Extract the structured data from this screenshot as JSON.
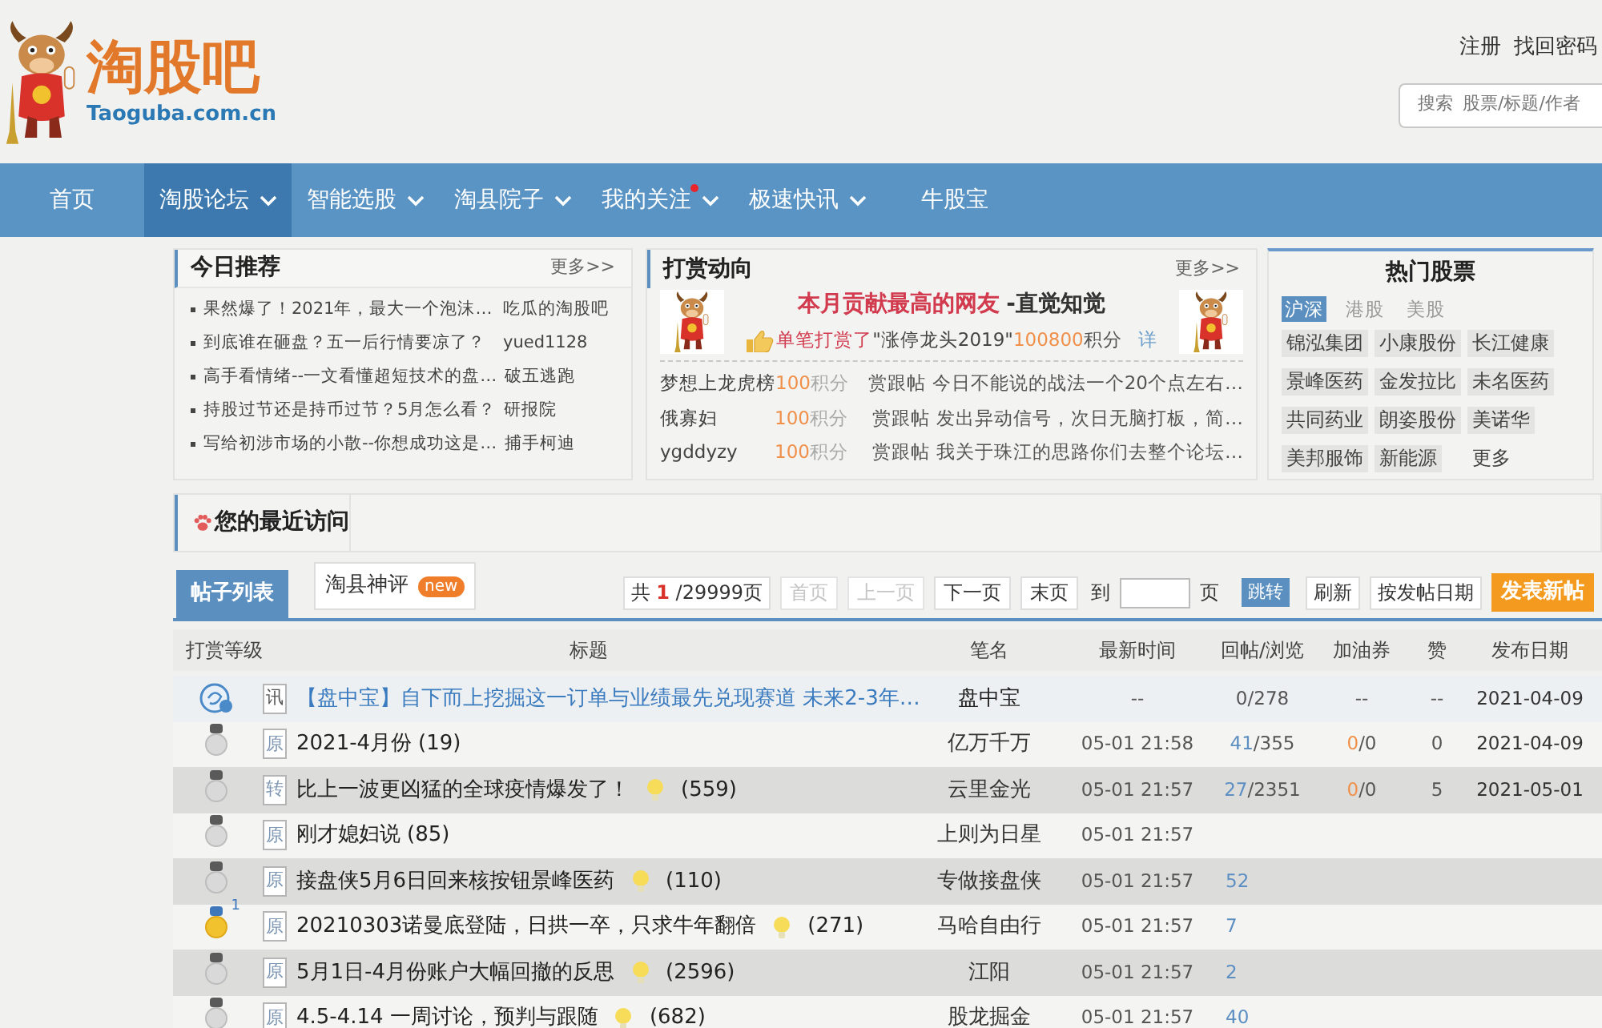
{
  "header": {
    "logo": {
      "name": "淘股吧",
      "domain": "Taoguba.com.cn"
    },
    "links": [
      "注册",
      "找回密码"
    ],
    "search": {
      "label": "搜索",
      "placeholder": "股票/标题/作者"
    }
  },
  "nav": [
    {
      "label": "首页",
      "selected": false,
      "dropdown": false,
      "dot": false
    },
    {
      "label": "淘股论坛",
      "selected": true,
      "dropdown": true,
      "dot": false
    },
    {
      "label": "智能选股",
      "selected": false,
      "dropdown": true,
      "dot": false
    },
    {
      "label": "淘县院子",
      "selected": false,
      "dropdown": true,
      "dot": false
    },
    {
      "label": "我的关注",
      "selected": false,
      "dropdown": true,
      "dot": true
    },
    {
      "label": "极速快讯",
      "selected": false,
      "dropdown": true,
      "dot": false
    },
    {
      "label": "牛股宝",
      "selected": false,
      "dropdown": false,
      "dot": false
    }
  ],
  "today": {
    "title": "今日推荐",
    "more": "更多>>",
    "items": [
      {
        "title": "果然爆了！2021年，最大一个泡沫…",
        "author": "吃瓜的淘股吧"
      },
      {
        "title": "到底谁在砸盘？五一后行情要凉了？",
        "author": "yued1128"
      },
      {
        "title": "高手看情绪--一文看懂超短技术的盘…",
        "author": "破五逃跑"
      },
      {
        "title": "持股过节还是持币过节？5月怎么看？",
        "author": "研报院"
      },
      {
        "title": "写给初涉市场的小散--你想成功这是…",
        "author": "捕手柯迪"
      }
    ]
  },
  "rewards": {
    "title": "打赏动向",
    "more": "更多>>",
    "top": {
      "headline": "本月贡献最高的网友",
      "user": "-直觉知觉",
      "action": "单笔打赏了",
      "target": "\"涨停龙头2019\"",
      "amount": "100800",
      "unit": "积分",
      "link": "详"
    },
    "rows": [
      {
        "user": "梦想上龙虎榜",
        "amount": "100",
        "unit": "积分",
        "action": "赏跟帖",
        "post": "今日不能说的战法一个20个点左右…"
      },
      {
        "user": "俄寡妇",
        "amount": "100",
        "unit": "积分",
        "action": "赏跟帖",
        "post": "发出异动信号，次日无脑打板，简…"
      },
      {
        "user": "ygddyzy",
        "amount": "100",
        "unit": "积分",
        "action": "赏跟帖",
        "post": "我关于珠江的思路你们去整个论坛…"
      }
    ]
  },
  "hot_stocks": {
    "title": "热门股票",
    "tabs": [
      {
        "label": "沪深",
        "selected": true
      },
      {
        "label": "港股",
        "selected": false
      },
      {
        "label": "美股",
        "selected": false
      }
    ],
    "stocks": [
      "锦泓集团",
      "小康股份",
      "长江健康",
      "景峰医药",
      "金发拉比",
      "未名医药",
      "共同药业",
      "朗姿股份",
      "美诺华",
      "美邦服饰",
      "新能源"
    ],
    "more": "更多"
  },
  "recent": {
    "title": "您的最近访问"
  },
  "posts": {
    "tabs": [
      {
        "label": "帖子列表",
        "selected": true
      },
      {
        "label": "淘县神评",
        "selected": false,
        "badge": "new"
      }
    ],
    "pager": {
      "total_prefix": "共",
      "page": "1",
      "total": "/29999页",
      "buttons": [
        {
          "label": "首页",
          "disabled": true
        },
        {
          "label": "上一页",
          "disabled": true
        },
        {
          "label": "下一页",
          "disabled": false
        },
        {
          "label": "末页",
          "disabled": false
        }
      ],
      "goto": "到",
      "goto_unit": "页",
      "jump": "跳转",
      "refresh": "刷新",
      "sort": "按发帖日期",
      "new_post": "发表新帖"
    },
    "columns": [
      "打赏等级",
      "标题",
      "笔名",
      "最新时间",
      "回帖/浏览",
      "加油券",
      "赞",
      "发布日期"
    ],
    "rows": [
      {
        "kind": "news",
        "medal": {
          "kind": "vip"
        },
        "tag": "讯",
        "title": "【盘中宝】自下而上挖掘这一订单与业绩最先兑现赛道 未来2-3年…",
        "bulb": false,
        "author": "盘中宝",
        "time": "--",
        "replies": "0",
        "views": "/278",
        "coupons": "--",
        "likes": "--",
        "date": "2021-04-09"
      },
      {
        "kind": "post",
        "medal": {
          "kind": "silver"
        },
        "tag": "原",
        "title": "2021-4月份",
        "bulb": false,
        "count": "(19)",
        "author": "亿万千万",
        "time": "05-01 21:58",
        "replies": "41",
        "views": "/355",
        "coupons": "0",
        "coupons_total": "/0",
        "likes": "0",
        "date": "2021-04-09"
      },
      {
        "kind": "post",
        "medal": {
          "kind": "silver"
        },
        "tag": "转",
        "title": "比上一波更凶猛的全球疫情爆发了！",
        "bulb": true,
        "count": "(559)",
        "author": "云里金光",
        "time": "05-01 21:57",
        "replies": "27",
        "views": "/2351",
        "coupons": "0",
        "coupons_total": "/0",
        "likes": "5",
        "date": "2021-05-01"
      },
      {
        "kind": "post",
        "medal": {
          "kind": "silver"
        },
        "tag": "原",
        "title": "刚才媳妇说",
        "bulb": false,
        "count": "(85)",
        "author": "上则为日星",
        "time": "05-01 21:57"
      },
      {
        "kind": "post",
        "medal": {
          "kind": "silver"
        },
        "tag": "原",
        "title": "接盘侠5月6日回来核按钮景峰医药",
        "bulb": true,
        "count": "(110)",
        "author": "专做接盘侠",
        "time": "05-01 21:57",
        "replies": "52"
      },
      {
        "kind": "post",
        "medal": {
          "kind": "gold",
          "count": "1"
        },
        "tag": "原",
        "title": "20210303诺曼底登陆，日拱一卒，只求牛年翻倍",
        "bulb": true,
        "count": "(271)",
        "author": "马哈自由行",
        "time": "05-01 21:57",
        "replies": "7"
      },
      {
        "kind": "post",
        "medal": {
          "kind": "silver"
        },
        "tag": "原",
        "title": "5月1日-4月份账户大幅回撤的反思",
        "bulb": true,
        "count": "(2596)",
        "author": "江阳",
        "time": "05-01 21:57",
        "replies": "2"
      },
      {
        "kind": "post",
        "medal": {
          "kind": "silver"
        },
        "tag": "原",
        "title": "4.5-4.14 一周讨论，预判与跟随",
        "bulb": true,
        "count": "(682)",
        "author": "股龙掘金",
        "time": "05-01 21:57",
        "replies": "40"
      }
    ]
  }
}
